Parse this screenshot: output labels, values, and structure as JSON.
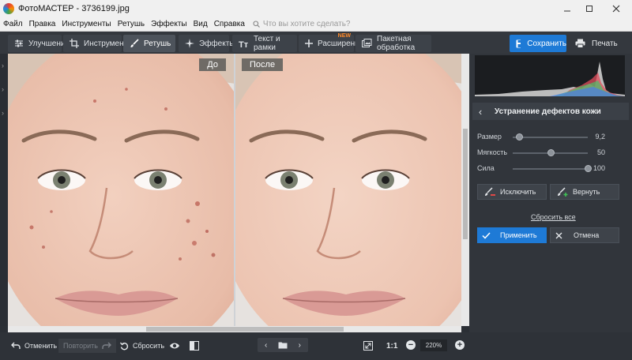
{
  "window": {
    "title": "ФотоМАСТЕР - 3736199.jpg"
  },
  "menu": {
    "items": [
      "Файл",
      "Правка",
      "Инструменты",
      "Ретушь",
      "Эффекты",
      "Вид",
      "Справка"
    ],
    "search_placeholder": "Что вы хотите сделать?"
  },
  "toolbar": {
    "tabs": [
      "Улучшения",
      "Инструменты",
      "Ретушь",
      "Эффекты",
      "Текст и рамки",
      "Расширения",
      "Пакетная обработка"
    ],
    "new_badge": "NEW",
    "save": "Сохранить",
    "print": "Печать"
  },
  "view": {
    "before_label": "До",
    "after_label": "После"
  },
  "panel": {
    "title": "Устранение дефектов кожи",
    "sliders": [
      {
        "label": "Размер",
        "value": "9,2",
        "level": 0.08
      },
      {
        "label": "Мягкость",
        "value": "50",
        "level": 0.5
      },
      {
        "label": "Сила",
        "value": "100",
        "level": 1.0
      }
    ],
    "exclude": "Исключить",
    "restore": "Вернуть",
    "reset_all": "Сбросить все",
    "apply": "Применить",
    "cancel": "Отмена"
  },
  "bottom": {
    "undo": "Отменить",
    "redo": "Повторить",
    "reset": "Сбросить",
    "ratio": "1:1",
    "zoom": "220%"
  },
  "colors": {
    "accent": "#1e7ad6",
    "panel_bg": "#31353b",
    "new_badge": "#ff8a2a"
  }
}
